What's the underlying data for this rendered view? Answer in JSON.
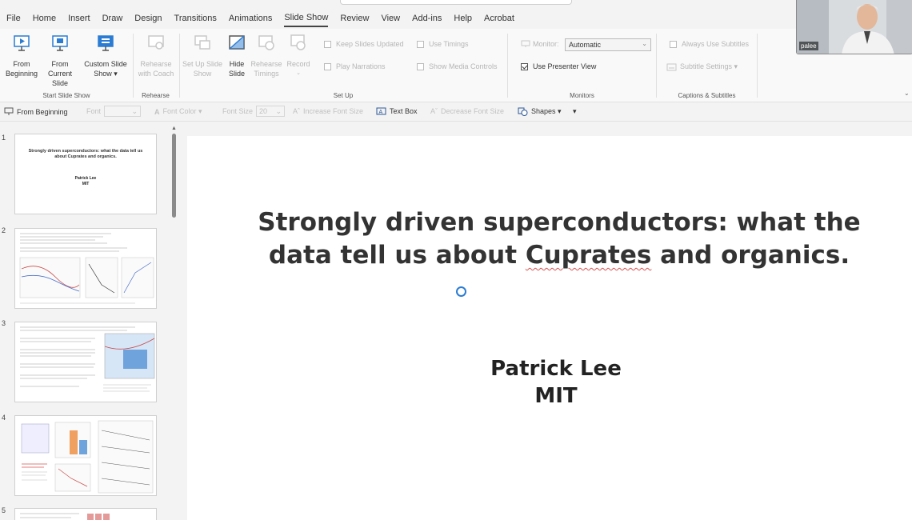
{
  "tabs": [
    "File",
    "Home",
    "Insert",
    "Draw",
    "Design",
    "Transitions",
    "Animations",
    "Slide Show",
    "Review",
    "View",
    "Add-ins",
    "Help",
    "Acrobat"
  ],
  "active_tab": "Slide Show",
  "ribbon": {
    "start": {
      "label": "Start Slide Show",
      "from_beginning": "From Beginning",
      "from_current": "From Current Slide",
      "custom": "Custom Slide Show ▾"
    },
    "rehearse": {
      "label": "Rehearse",
      "with_coach": "Rehearse with Coach"
    },
    "setup": {
      "label": "Set Up",
      "set_up": "Set Up Slide Show",
      "hide": "Hide Slide",
      "timings": "Rehearse Timings",
      "record": "Record",
      "keep_updated": "Keep Slides Updated",
      "play_narrations": "Play Narrations",
      "use_timings": "Use Timings",
      "show_media": "Show Media Controls"
    },
    "monitors": {
      "label": "Monitors",
      "monitor": "Monitor:",
      "monitor_value": "Automatic",
      "presenter_view": "Use Presenter View"
    },
    "captions": {
      "label": "Captions & Subtitles",
      "always": "Always Use Subtitles",
      "settings": "Subtitle Settings ▾"
    }
  },
  "qat": {
    "from_beginning": "From Beginning",
    "font": "Font",
    "font_color": "Font Color ▾",
    "font_size": "Font Size",
    "font_size_value": "20",
    "increase": "Increase Font Size",
    "text_box": "Text Box",
    "decrease": "Decrease Font Size",
    "shapes": "Shapes ▾"
  },
  "slides": {
    "numbers": [
      "1",
      "2",
      "3",
      "4",
      "5"
    ],
    "thumb1": {
      "title": "Strongly driven superconductors: what the data tell us about Cuprates and organics.",
      "author": "Patrick Lee",
      "affil": "MIT"
    }
  },
  "slide": {
    "title_line1": "Strongly driven superconductors: what the",
    "title_line2_a": "data tell us about ",
    "title_line2_b": "Cuprates",
    "title_line2_c": " and organics.",
    "author": "Patrick Lee",
    "affiliation": "MIT"
  },
  "webcam": {
    "label": "palee"
  },
  "colors": {
    "accent": "#2b7cd3",
    "ribbon_bg": "#f9f9f9",
    "app_bg": "#f3f3f3"
  }
}
